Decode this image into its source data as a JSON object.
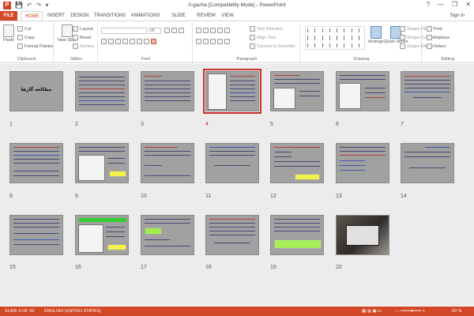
{
  "window": {
    "title": "0-gazha [Compatibility Mode] - PowerPoint",
    "controls": [
      "?",
      "—",
      "❐",
      "✕"
    ]
  },
  "quick_access": [
    "💾",
    "↶",
    "↷",
    "▾"
  ],
  "tabs": [
    "FILE",
    "HOME",
    "INSERT",
    "DESIGN",
    "TRANSITIONS",
    "ANIMATIONS",
    "SLIDE SHOW",
    "REVIEW",
    "VIEW"
  ],
  "active_tab": "HOME",
  "sign_in": "Sign in",
  "ribbon": {
    "clipboard": {
      "label": "Clipboard",
      "paste": "Paste",
      "cut": "Cut",
      "copy": "Copy",
      "format_painter": "Format Painter"
    },
    "slides": {
      "label": "Slides",
      "new_slide": "New Slide",
      "layout": "Layout",
      "reset": "Reset",
      "section": "Section"
    },
    "font": {
      "label": "Font",
      "font_name": "",
      "font_size": "28"
    },
    "paragraph": {
      "label": "Paragraph",
      "text_direction": "Text Direction",
      "align_text": "Align Text",
      "smartart": "Convert to SmartArt"
    },
    "drawing": {
      "label": "Drawing",
      "arrange": "Arrange",
      "quick_styles": "Quick Styles",
      "shape_fill": "Shape Fill",
      "shape_outline": "Shape Outline",
      "shape_effects": "Shape Effects"
    },
    "editing": {
      "label": "Editing",
      "find": "Find",
      "replace": "Replace",
      "select": "Select"
    }
  },
  "slides": [
    {
      "n": "1",
      "title": "مطالعه گازها"
    },
    {
      "n": "2"
    },
    {
      "n": "3"
    },
    {
      "n": "4",
      "selected": true
    },
    {
      "n": "5"
    },
    {
      "n": "6"
    },
    {
      "n": "7"
    },
    {
      "n": "8"
    },
    {
      "n": "9"
    },
    {
      "n": "10"
    },
    {
      "n": "11"
    },
    {
      "n": "12"
    },
    {
      "n": "13"
    },
    {
      "n": "14"
    },
    {
      "n": "15"
    },
    {
      "n": "16"
    },
    {
      "n": "17"
    },
    {
      "n": "18"
    },
    {
      "n": "19"
    },
    {
      "n": "20"
    }
  ],
  "status": {
    "slide_info": "SLIDE 4 OF 20",
    "language": "ENGLISH (UNITED STATES)",
    "zoom": "63 %"
  }
}
